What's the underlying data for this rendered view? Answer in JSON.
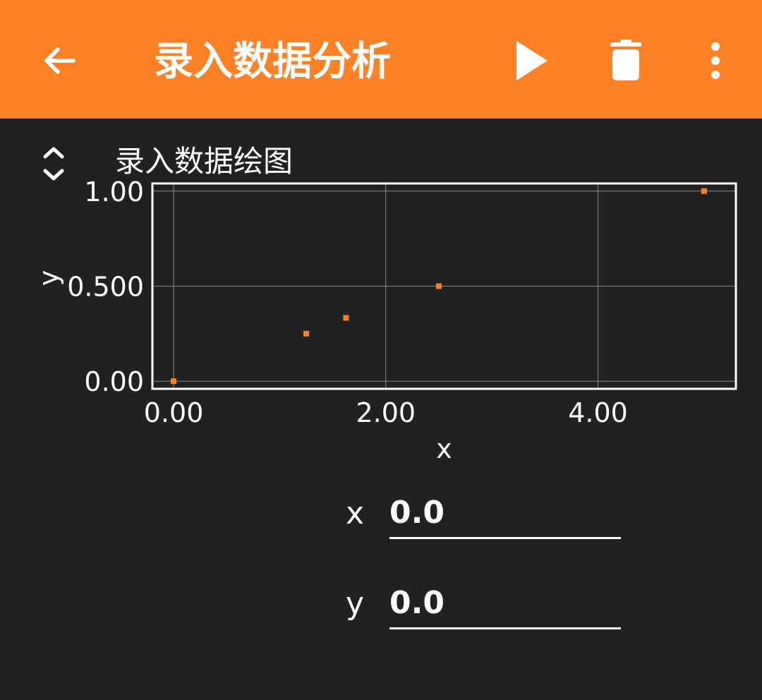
{
  "app_bar": {
    "title": "录入数据分析",
    "icons": [
      "arrow-back-icon",
      "play-icon",
      "trash-icon",
      "more-vert-icon"
    ],
    "background_color": "#ff8126"
  },
  "section": {
    "title": "录入数据绘图",
    "toggle_icon": "unfold-icon"
  },
  "chart_data": {
    "type": "scatter",
    "xlabel": "x",
    "ylabel": "y",
    "x_ticks": [
      "0.00",
      "2.00",
      "4.00"
    ],
    "y_ticks": [
      "0.00",
      "0.500",
      "1.00"
    ],
    "xlim": [
      -0.2,
      5.3
    ],
    "ylim": [
      -0.04,
      1.04
    ],
    "grid": true,
    "marker_color": "#ff8126",
    "series": [
      {
        "x": [
          0.0,
          1.25,
          1.625,
          2.5,
          5.0
        ],
        "y": [
          0.0,
          0.25,
          0.333,
          0.5,
          1.0
        ]
      }
    ]
  },
  "inputs": {
    "x_label": "x",
    "x_value": "0.0",
    "y_label": "y",
    "y_value": "0.0"
  }
}
